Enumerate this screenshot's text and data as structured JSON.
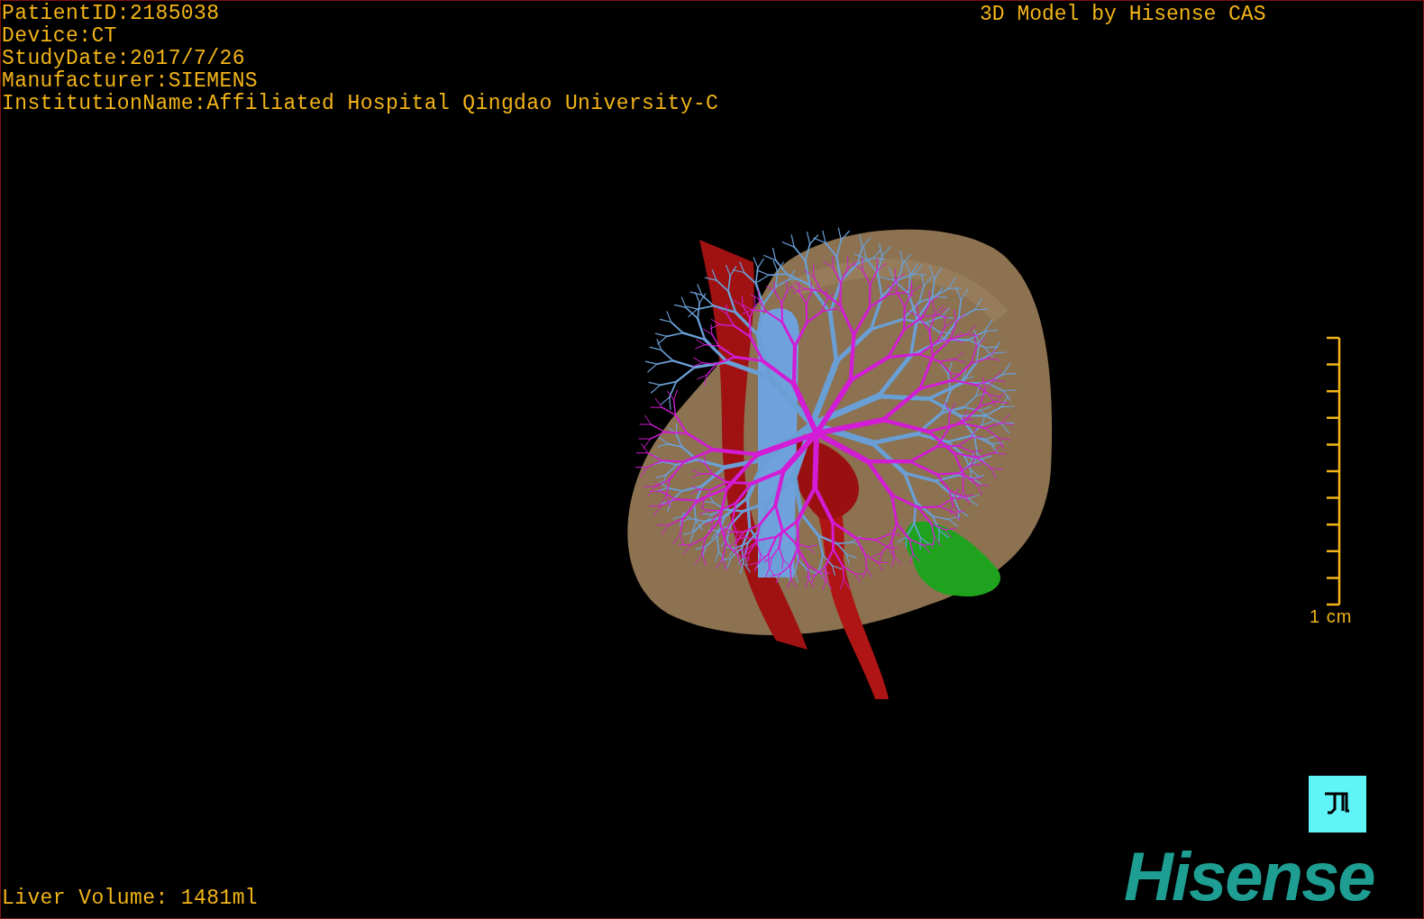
{
  "study_info": [
    "PatientID:2185038",
    "Device:CT",
    "StudyDate:2017/7/26",
    "Manufacturer:SIEMENS",
    "InstitutionName:Affiliated Hospital Qingdao University-C"
  ],
  "title": "3D Model by Hisense CAS",
  "scale_bar": {
    "label": "1 cm"
  },
  "liver_volume": "Liver Volume: 1481ml",
  "logo": "Hisense"
}
